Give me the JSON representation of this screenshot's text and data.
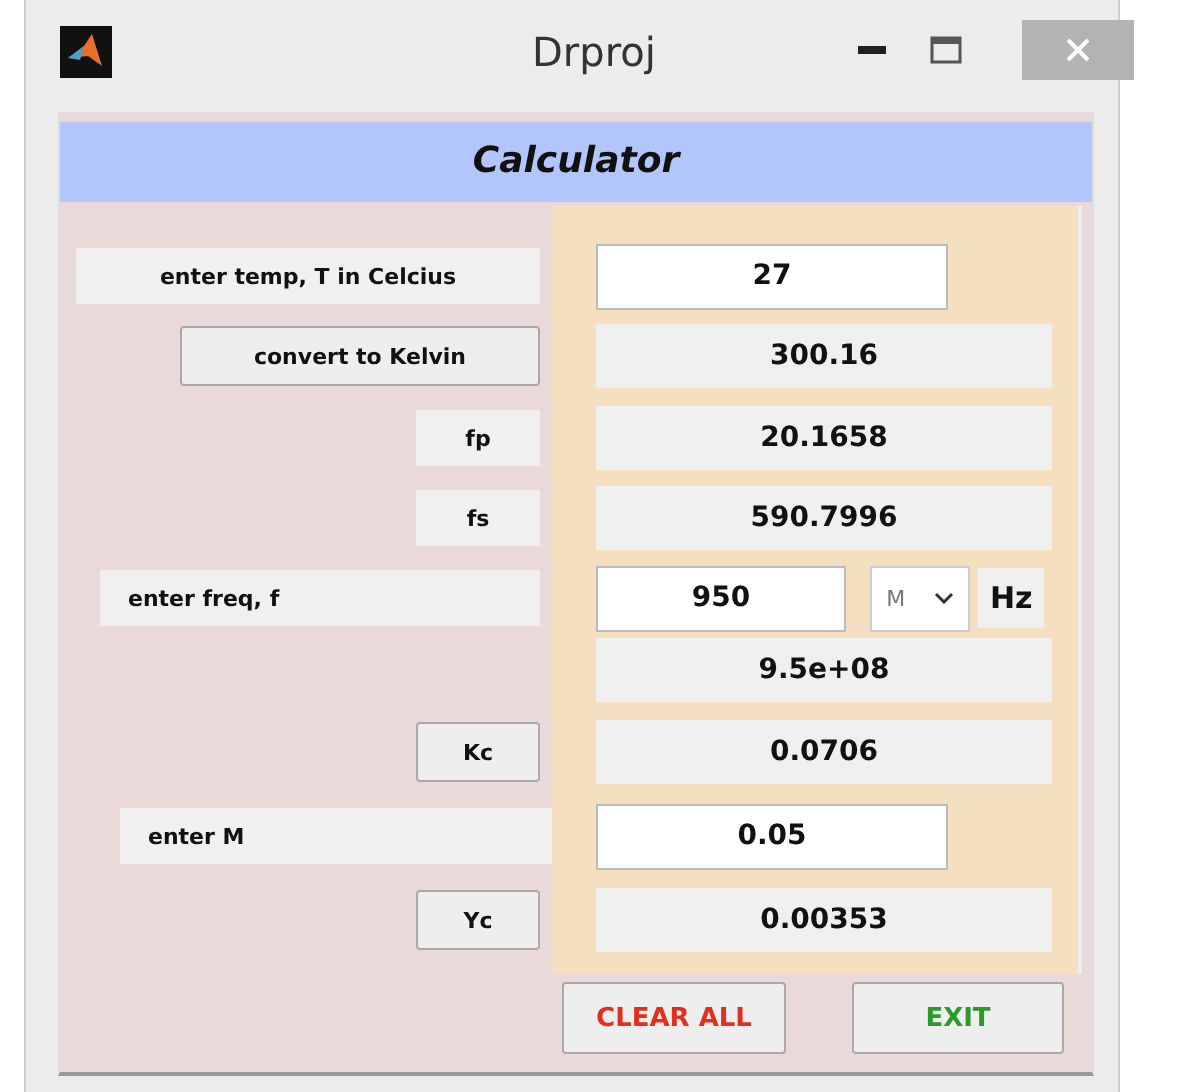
{
  "window": {
    "title": "Drproj"
  },
  "header": "Calculator",
  "temperature": {
    "label": "enter temp, T in Celcius",
    "value": "27"
  },
  "convert": {
    "button": "convert to Kelvin",
    "value": "300.16"
  },
  "fp": {
    "label": "fp",
    "value": "20.1658"
  },
  "fs": {
    "label": "fs",
    "value": "590.7996"
  },
  "frequency": {
    "label": "enter freq, f",
    "value": "950",
    "unit": "M",
    "suffix": "Hz",
    "result": "9.5e+08"
  },
  "kc": {
    "button": "Kc",
    "value": "0.0706"
  },
  "m": {
    "label": "enter M",
    "value": "0.05"
  },
  "yc": {
    "button": "Yc",
    "value": "0.00353"
  },
  "actions": {
    "clear": "CLEAR ALL",
    "exit": "EXIT"
  }
}
